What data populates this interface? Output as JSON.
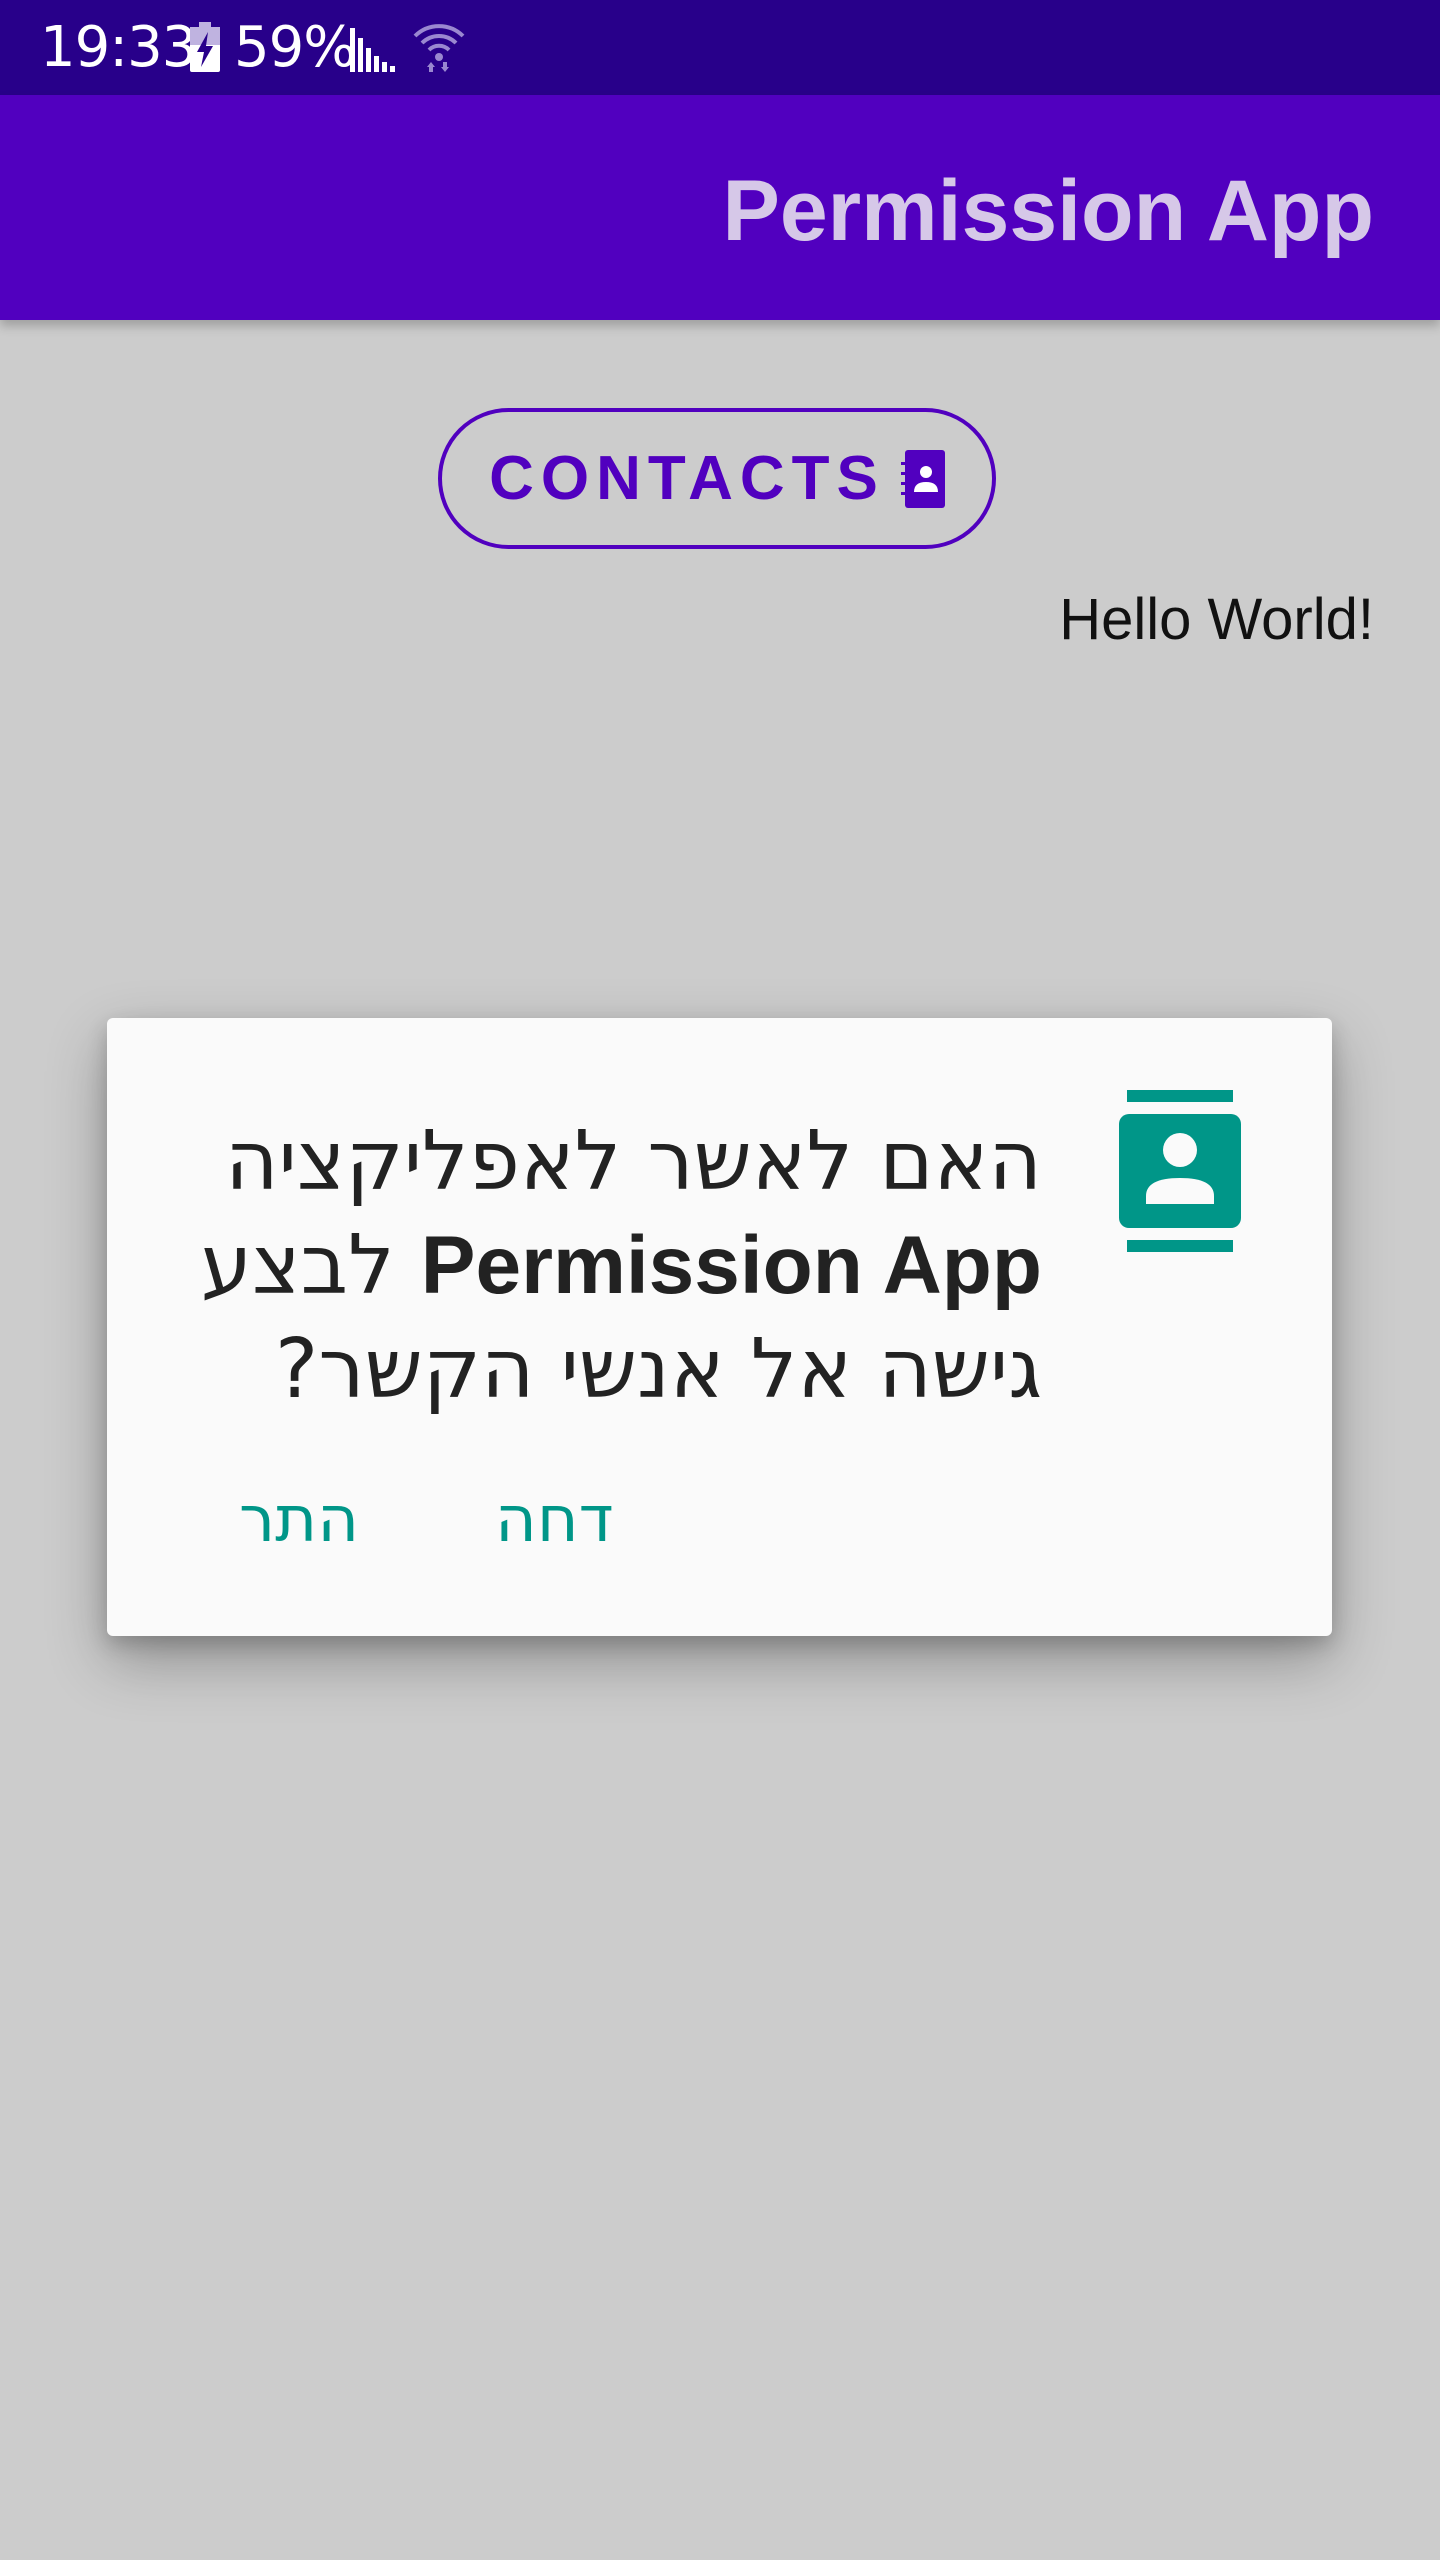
{
  "status_bar": {
    "time": "19:33",
    "battery": "59%",
    "icons": [
      "battery-charging-icon",
      "signal-icon",
      "wifi-icon"
    ]
  },
  "app_bar": {
    "title": "Permission App"
  },
  "main": {
    "contacts_button_label": "CONTACTS",
    "contacts_button_icon": "contacts-book-icon",
    "hello_text": "Hello World!"
  },
  "dialog": {
    "icon": "contact-card-icon",
    "message_prefix": "האם לאשר לאפליקציה",
    "app_name": "Permission App",
    "message_suffix": "לבצע גישה אל אנשי הקשר?",
    "deny_label": "דחה",
    "allow_label": "התר"
  },
  "colors": {
    "status_bar": "#28008a",
    "app_bar": "#5100bf",
    "app_title": "#d6c8e8",
    "background": "#cccccc",
    "dialog_background": "#fafafa",
    "accent": "#009688"
  }
}
